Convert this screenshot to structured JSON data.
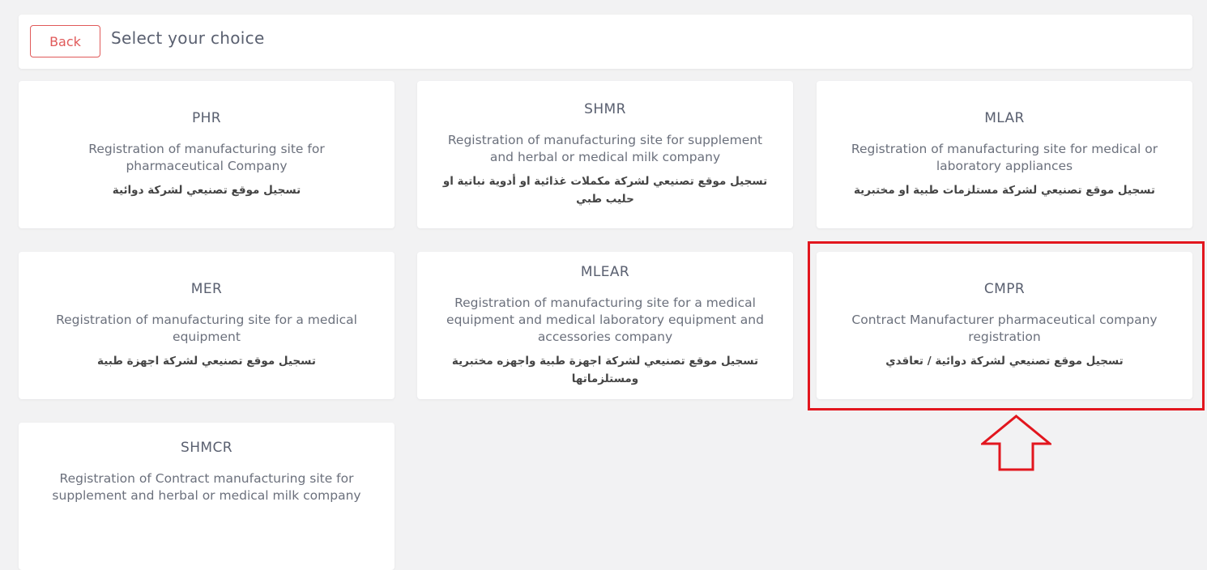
{
  "header": {
    "back_label": "Back",
    "title": "Select your choice"
  },
  "cards": [
    {
      "code": "PHR",
      "description": "Registration of manufacturing site for pharmaceutical Company",
      "arabic": "تسجيل موقع تصنيعي لشركة دوائية"
    },
    {
      "code": "SHMR",
      "description": "Registration of manufacturing site for supplement and herbal or medical milk company",
      "arabic": "تسجيل موقع تصنيعي لشركة مكملات غذائية او أدوية نباتية او حليب طبي"
    },
    {
      "code": "MLAR",
      "description": "Registration of manufacturing site for medical or laboratory appliances",
      "arabic": "تسجيل موقع تصنيعي لشركة مستلزمات طبية او مختبرية"
    },
    {
      "code": "MER",
      "description": "Registration of manufacturing site for a medical equipment",
      "arabic": "تسجيل موقع تصنيعي لشركة اجهزة طبية"
    },
    {
      "code": "MLEAR",
      "description": "Registration of manufacturing site for a medical equipment and medical laboratory equipment and accessories company",
      "arabic": "تسجيل موقع تصنيعي لشركة اجهزة طبية واجهزه مختبرية ومستلزماتها"
    },
    {
      "code": "CMPR",
      "description": "Contract Manufacturer pharmaceutical company registration",
      "arabic": "تسجيل موقع تصنيعي لشركة دوائية / تعاقدي"
    },
    {
      "code": "SHMCR",
      "description": "Registration of Contract manufacturing site for supplement and herbal or medical milk company",
      "arabic": ""
    }
  ],
  "annotation": {
    "highlight_color": "#e2161e",
    "highlighted_card": "CMPR",
    "arrow_icon": "up-arrow-icon"
  }
}
